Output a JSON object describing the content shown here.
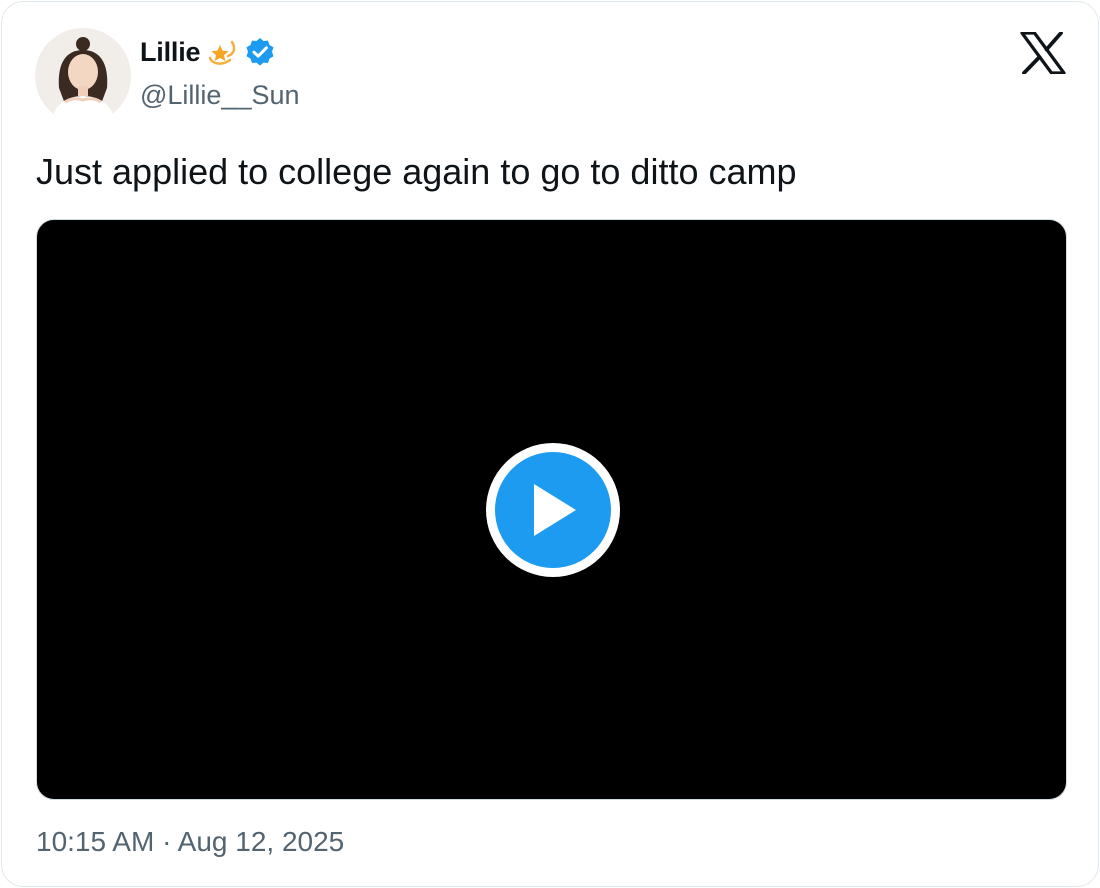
{
  "author": {
    "display_name": "Lillie",
    "name_emoji_icon": "dizzy-star-icon",
    "verified_icon": "verified-badge-icon",
    "handle": "@Lillie__Sun",
    "avatar_icon": "profile-photo"
  },
  "platform_logo": "x-logo-icon",
  "tweet": {
    "text": "Just applied to college again to go to ditto camp"
  },
  "media": {
    "type": "video",
    "play_icon": "play-icon"
  },
  "meta": {
    "timestamp": "10:15 AM · Aug 12, 2025"
  },
  "colors": {
    "accent": "#1d9bf0",
    "text_primary": "#0f1419",
    "text_secondary": "#536471",
    "border": "#e1e8ed",
    "video_background": "#000000"
  }
}
